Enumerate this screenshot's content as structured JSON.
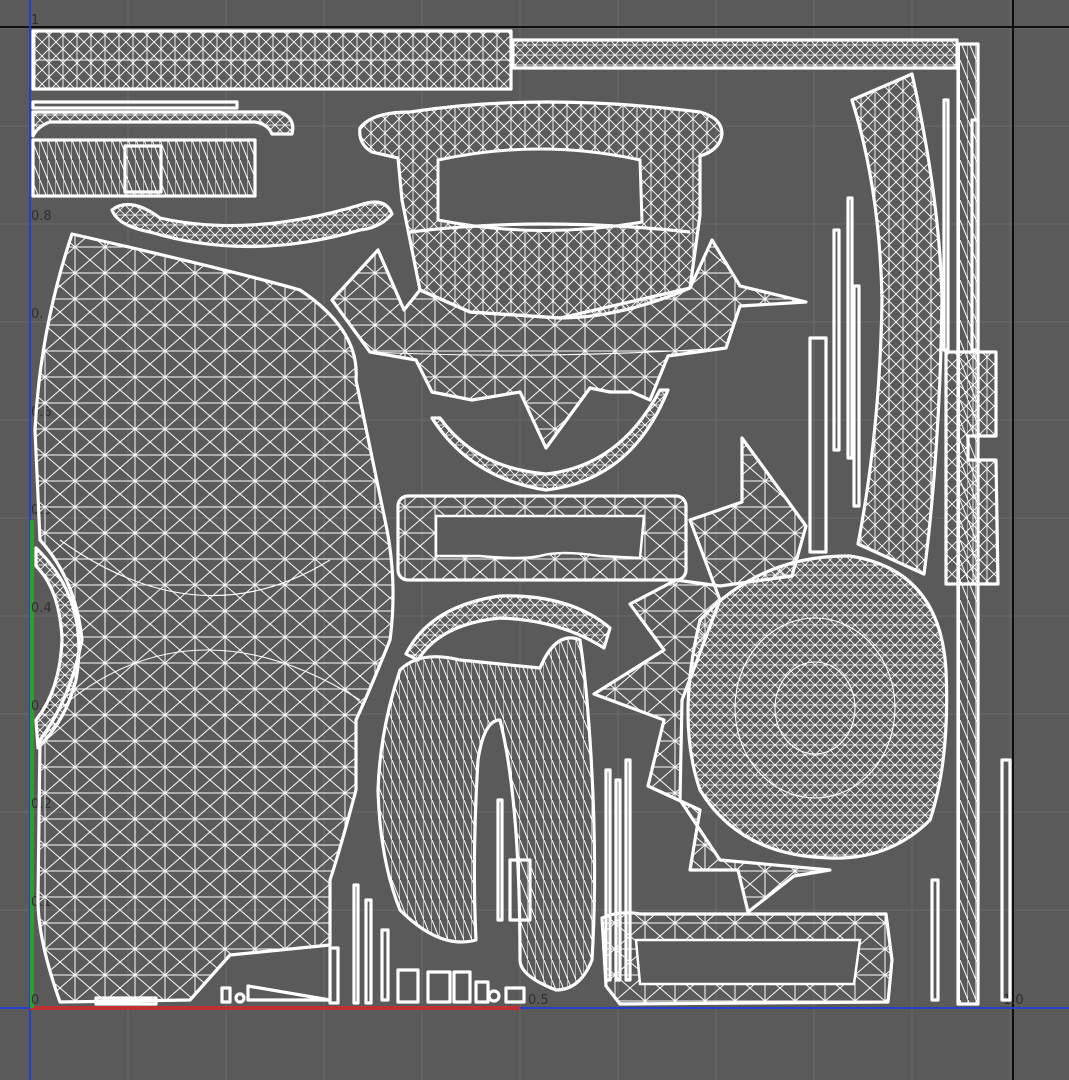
{
  "viewport": {
    "background": "#5a5a5a",
    "grid_color": "#6b6b6b",
    "border_color": "#101010",
    "wire_color": "#ffffff",
    "u_axis_color": "#c03030",
    "v_axis_color": "#2aa030",
    "axis_line_color": "#2040d0"
  },
  "axis_ticks": [
    "1",
    "0.8",
    "0.",
    "0.6",
    "0.5",
    "0.4",
    "0.3",
    "0.2",
    "0.1",
    "0",
    "0.5",
    "1.0"
  ],
  "uv_shells": [
    "top-strip",
    "long-top-strip",
    "small-curve-top-left",
    "segments-block",
    "arc-upper-left",
    "big-left-shell",
    "left-edge-arc",
    "top-center-cup",
    "spike-crown",
    "lower-arc",
    "mid-frame",
    "spiky-ring",
    "round-disc",
    "right-curve-strip",
    "right-vertical-strip",
    "right-bow-tie",
    "bottom-frame",
    "horseshoe",
    "small-arc",
    "thin-slivers",
    "bottom-pieces"
  ]
}
